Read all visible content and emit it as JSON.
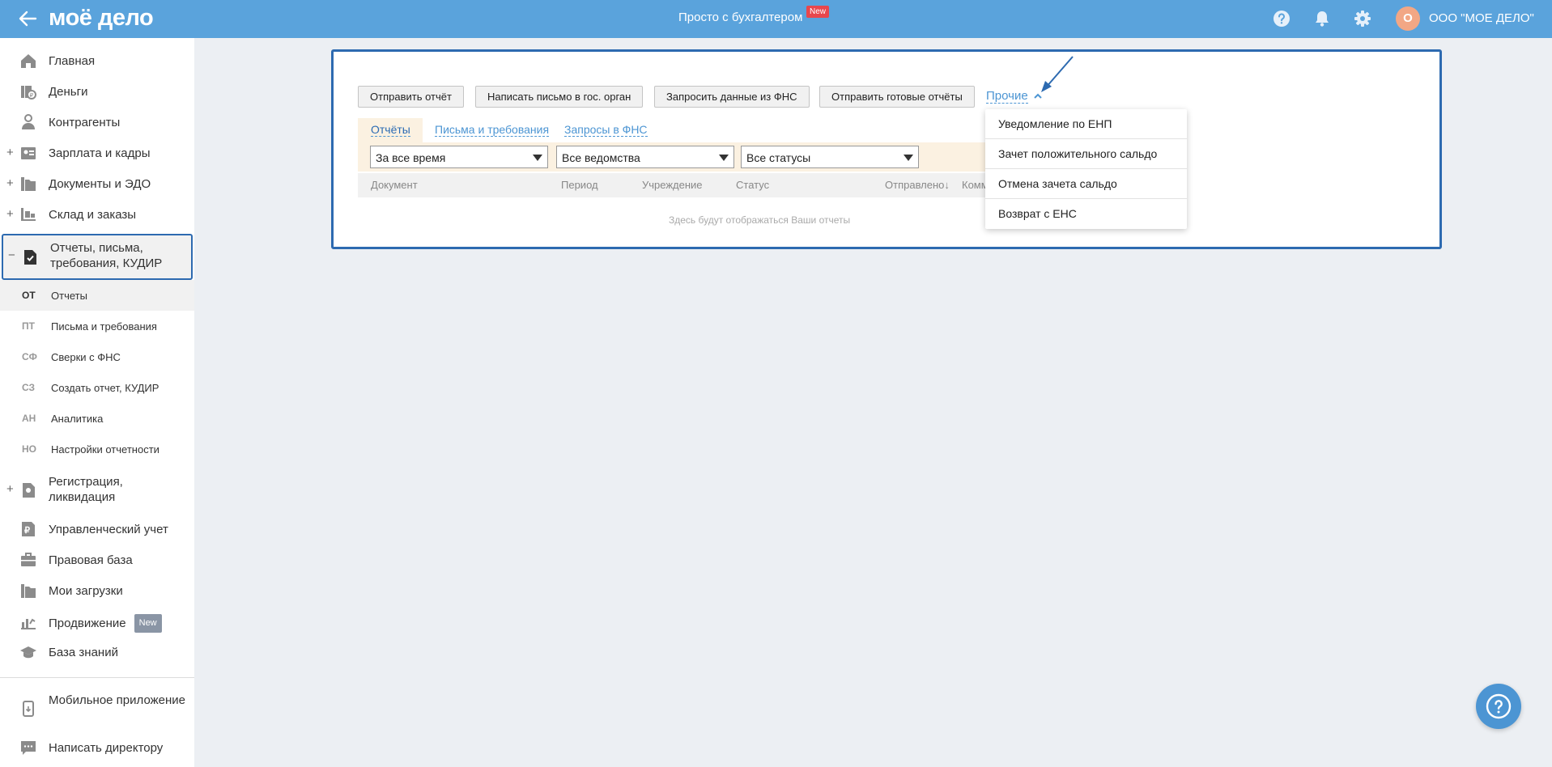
{
  "header": {
    "logo": "моё дело",
    "center_title": "Просто с бухгалтером",
    "new_badge": "New",
    "avatar_letter": "О",
    "company": "ООО \"МОЕ ДЕЛО\"",
    "icons": [
      "back-arrow-icon",
      "help-icon",
      "bell-icon",
      "gear-icon"
    ],
    "bar_color": "#5aa3dc"
  },
  "sidebar": {
    "items": [
      {
        "label": "Главная",
        "icon": "home-icon"
      },
      {
        "label": "Деньги",
        "icon": "money-icon"
      },
      {
        "label": "Контрагенты",
        "icon": "contractor-icon"
      },
      {
        "label": "Зарплата и кадры",
        "icon": "salary-icon",
        "expander": "+"
      },
      {
        "label": "Документы и ЭДО",
        "icon": "folder-icon",
        "expander": "+"
      },
      {
        "label": "Склад и заказы",
        "icon": "warehouse-icon",
        "expander": "+"
      },
      {
        "label": "Отчеты, письма, требования, КУДИР",
        "icon": "report-icon",
        "expander": "−"
      },
      {
        "label": "Регистрация, ликвидация",
        "icon": "registration-icon",
        "expander": "+"
      },
      {
        "label": "Управленческий учет",
        "icon": "ruble-doc-icon"
      },
      {
        "label": "Правовая база",
        "icon": "briefcase-icon"
      },
      {
        "label": "Мои загрузки",
        "icon": "downloads-folder-icon"
      },
      {
        "label": "Продвижение",
        "icon": "promotion-icon",
        "badge": "New"
      },
      {
        "label": "База знаний",
        "icon": "graduation-cap-icon"
      },
      {
        "label": "Мобильное приложение",
        "icon": "mobile-icon"
      },
      {
        "label": "Написать директору",
        "icon": "chat-icon"
      }
    ],
    "sub_items": [
      {
        "abbr": "ОТ",
        "label": "Отчеты"
      },
      {
        "abbr": "ПТ",
        "label": "Письма и требования"
      },
      {
        "abbr": "СФ",
        "label": "Сверки с ФНС"
      },
      {
        "abbr": "СЗ",
        "label": "Создать отчет, КУДИР"
      },
      {
        "abbr": "АН",
        "label": "Аналитика"
      },
      {
        "abbr": "НО",
        "label": "Настройки отчетности"
      }
    ]
  },
  "toolbar": {
    "buttons": [
      "Отправить отчёт",
      "Написать письмо в гос. орган",
      "Запросить данные из ФНС",
      "Отправить готовые отчёты"
    ],
    "other_link": "Прочие"
  },
  "tabs": [
    "Отчёты",
    "Письма и требования",
    "Запросы в ФНС"
  ],
  "filters": [
    "За все время",
    "Все ведомства",
    "Все статусы"
  ],
  "table": {
    "columns": [
      "Документ",
      "Период",
      "Учреждение",
      "Статус",
      "Отправлено↓",
      "Комм"
    ],
    "empty_text": "Здесь будут отображаться Ваши отчеты"
  },
  "dropdown": [
    "Уведомление по ЕНП",
    "Зачет положительного сальдо",
    "Отмена зачета сальдо",
    "Возврат с ЕНС"
  ],
  "colors": {
    "accent": "#2d6ab0",
    "link": "#4c95d3",
    "badge_red": "#e8474d"
  }
}
